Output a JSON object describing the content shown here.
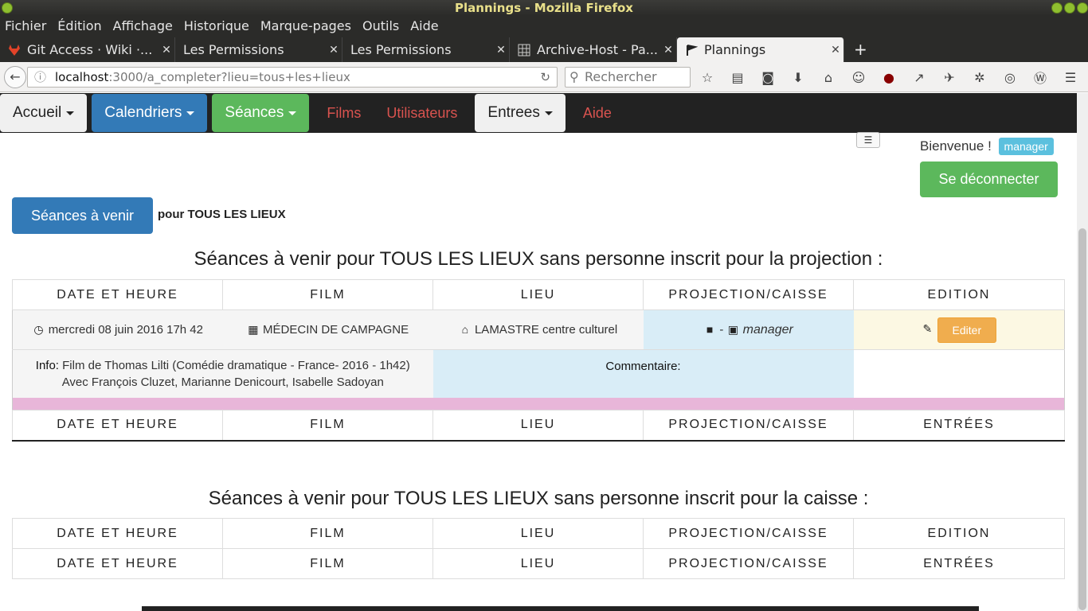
{
  "browser": {
    "window_title": "Plannings - Mozilla Firefox",
    "menu": [
      "Fichier",
      "Édition",
      "Affichage",
      "Historique",
      "Marque-pages",
      "Outils",
      "Aide"
    ],
    "tabs": [
      {
        "label": "Git Access · Wiki ·...",
        "icon": "gitlab-icon"
      },
      {
        "label": "Les Permissions",
        "icon": ""
      },
      {
        "label": "Les Permissions",
        "icon": ""
      },
      {
        "label": "Archive-Host - Pa...",
        "icon": "grid-icon"
      },
      {
        "label": "Plannings",
        "icon": "flag-icon"
      }
    ],
    "url_host": "localhost",
    "url_path": ":3000/a_completer?lieu=tous+les+lieux",
    "search_placeholder": "Rechercher"
  },
  "nav": {
    "accueil": "Accueil",
    "calendriers": "Calendriers",
    "seances": "Séances",
    "films": "Films",
    "utilisateurs": "Utilisateurs",
    "entrees": "Entrees",
    "aide": "Aide"
  },
  "user": {
    "welcome": "Bienvenue !",
    "name": "manager",
    "logout": "Se déconnecter"
  },
  "filter": {
    "button": "Séances à venir",
    "place": "pour TOUS LES LIEUX"
  },
  "section1": {
    "title": "Séances à venir pour TOUS LES LIEUX sans personne inscrit pour la projection :",
    "headers": [
      "DATE ET HEURE",
      "FILM",
      "LIEU",
      "PROJECTION/CAISSE",
      "EDITION"
    ],
    "footer_headers": [
      "DATE ET HEURE",
      "FILM",
      "LIEU",
      "PROJECTION/CAISSE",
      "ENTRÉES"
    ],
    "row": {
      "date": "mercredi 08 juin 2016 17h 42",
      "film": "MÉDECIN DE CAMPAGNE",
      "lieu": "LAMASTRE centre culturel",
      "dash": "-",
      "assignee": "manager",
      "edit": "Editer",
      "info_label": "Info:",
      "info_line1": "Film de Thomas Lilti (Comédie dramatique - France- 2016 - 1h42)",
      "info_line2": "Avec François Cluzet, Marianne Denicourt, Isabelle Sadoyan",
      "comment_label": "Commentaire:"
    }
  },
  "section2": {
    "title": "Séances à venir pour TOUS LES LIEUX sans personne inscrit pour la caisse :",
    "headers": [
      "DATE ET HEURE",
      "FILM",
      "LIEU",
      "PROJECTION/CAISSE",
      "EDITION"
    ],
    "footer_headers": [
      "DATE ET HEURE",
      "FILM",
      "LIEU",
      "PROJECTION/CAISSE",
      "ENTRÉES"
    ]
  }
}
